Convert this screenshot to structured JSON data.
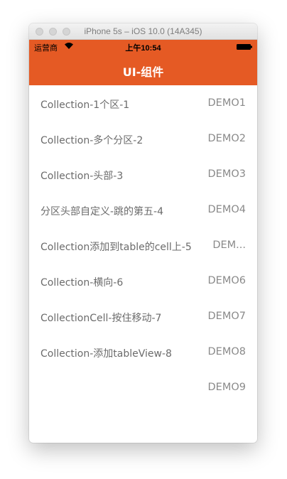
{
  "window": {
    "title": "iPhone 5s – iOS 10.0 (14A345)"
  },
  "statusbar": {
    "carrier": "运营商",
    "time": "上午10:54"
  },
  "navbar": {
    "title": "UI-组件"
  },
  "rows": [
    {
      "title": "Collection-1个区-1",
      "detail": "DEMO1"
    },
    {
      "title": "Collection-多个分区-2",
      "detail": "DEMO2"
    },
    {
      "title": "Collection-头部-3",
      "detail": "DEMO3"
    },
    {
      "title": "分区头部自定义-跳的第五-4",
      "detail": "DEMO4"
    },
    {
      "title": "Collection添加到table的cell上-5",
      "detail": "DEM..."
    },
    {
      "title": "Collection-横向-6",
      "detail": "DEMO6"
    },
    {
      "title": "CollectionCell-按住移动-7",
      "detail": "DEMO7"
    },
    {
      "title": "Collection-添加tableView-8",
      "detail": "DEMO8"
    },
    {
      "title": "",
      "detail": "DEMO9"
    }
  ],
  "colors": {
    "accent": "#e55a24",
    "text": "#6b6b6b",
    "detail": "#8a8a8a"
  }
}
